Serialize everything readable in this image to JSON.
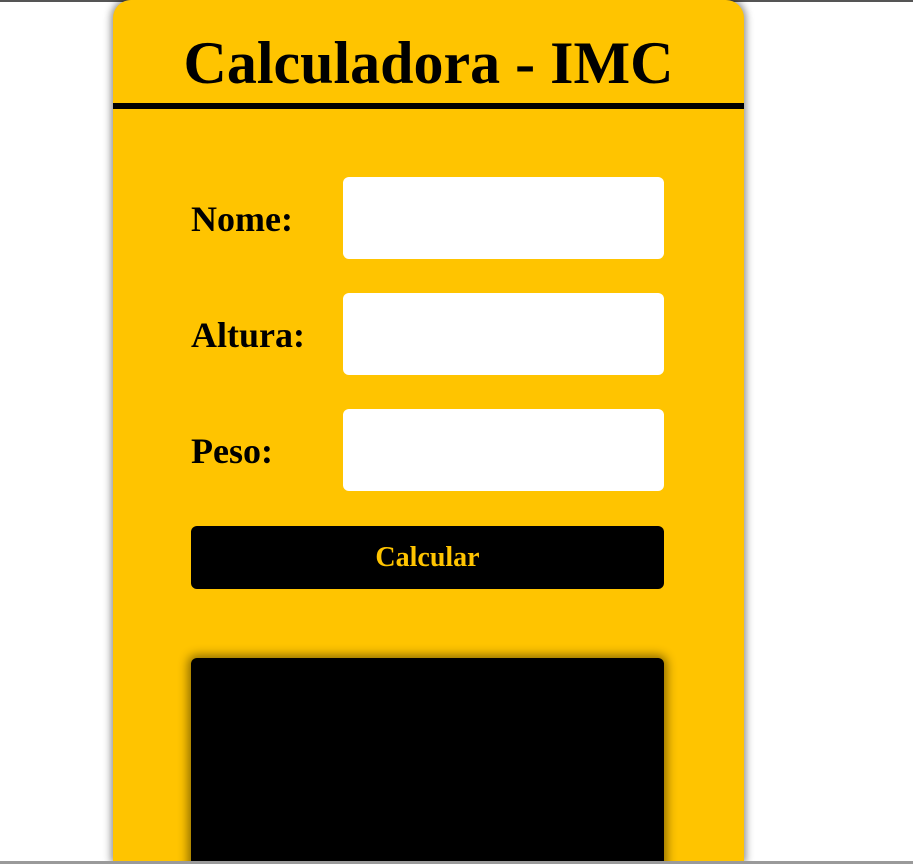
{
  "form": {
    "title": "Calculadora - IMC",
    "fields": [
      {
        "label": "Nome:",
        "value": ""
      },
      {
        "label": "Altura:",
        "value": ""
      },
      {
        "label": "Peso:",
        "value": ""
      }
    ],
    "calculate_label": "Calcular",
    "result_text": ""
  },
  "colors": {
    "background": "#ffffff",
    "card": "#ffc400",
    "button": "#000000",
    "button_text": "#ffc400",
    "result_box": "#000000"
  }
}
